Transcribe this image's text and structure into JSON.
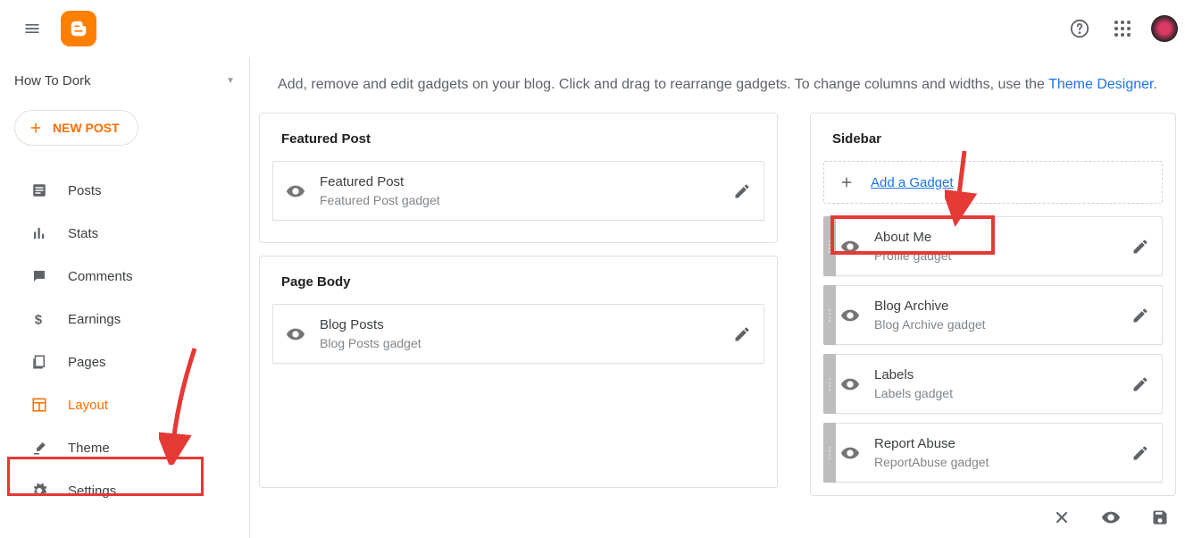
{
  "topbar": {
    "blog_name": "How To Dork"
  },
  "newpost": {
    "label": "NEW POST"
  },
  "nav": {
    "posts": "Posts",
    "stats": "Stats",
    "comments": "Comments",
    "earnings": "Earnings",
    "pages": "Pages",
    "layout": "Layout",
    "theme": "Theme",
    "settings": "Settings"
  },
  "info": {
    "text_before": "Add, remove and edit gadgets on your blog. Click and drag to rearrange gadgets. To change columns and widths, use the ",
    "link": "Theme Designer",
    "text_after": "."
  },
  "sections": {
    "featured": {
      "title": "Featured Post",
      "gadget": {
        "title": "Featured Post",
        "sub": "Featured Post gadget"
      }
    },
    "pagebody": {
      "title": "Page Body",
      "gadget": {
        "title": "Blog Posts",
        "sub": "Blog Posts gadget"
      }
    },
    "sidebar": {
      "title": "Sidebar",
      "add_label": "Add a Gadget",
      "items": [
        {
          "title": "About Me",
          "sub": "Profile gadget"
        },
        {
          "title": "Blog Archive",
          "sub": "Blog Archive gadget"
        },
        {
          "title": "Labels",
          "sub": "Labels gadget"
        },
        {
          "title": "Report Abuse",
          "sub": "ReportAbuse gadget"
        }
      ]
    }
  }
}
